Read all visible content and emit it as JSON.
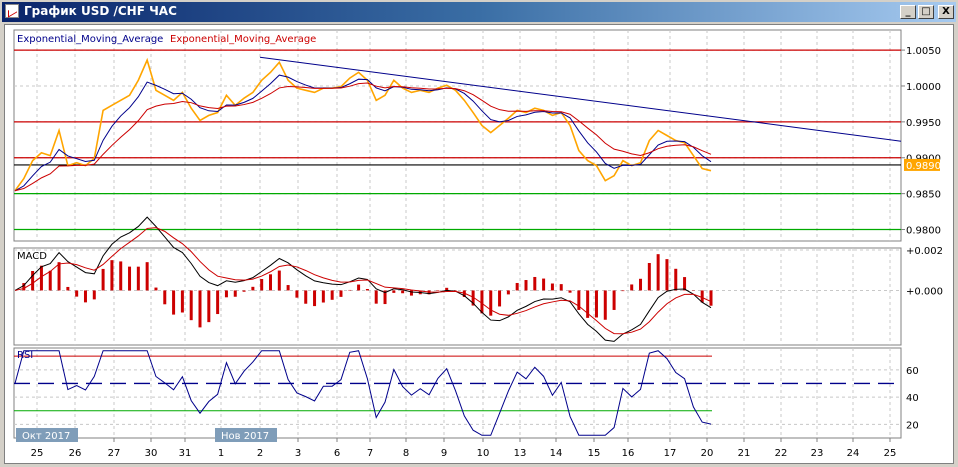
{
  "window": {
    "title": "График USD /CHF  ЧАС",
    "buttons": {
      "minimize": "_",
      "maximize": "□",
      "close": "X"
    }
  },
  "colors": {
    "price": "#ffa500",
    "ema_fast": "#00008b",
    "ema_slow": "#cc0000",
    "resistance": "#cc0000",
    "support": "#00aa00",
    "current": "#000000",
    "trendline": "#00008b",
    "price_tag_bg": "#ffa500"
  },
  "chart_data": [
    {
      "type": "line",
      "panel": "price",
      "legend": [
        "Exponential_Moving_Average",
        "Exponential_Moving_Average"
      ],
      "ylim": [
        0.9784,
        1.0078
      ],
      "yticks": [
        "1.0050",
        "1.0000",
        "0.9950",
        "0.9900",
        "0.9850",
        "0.9800"
      ],
      "current_price": "0.9890",
      "grid": true,
      "x_day_labels": [
        "25",
        "26",
        "27",
        "30",
        "31",
        "1",
        "2",
        "3",
        "6",
        "7",
        "8",
        "9",
        "10",
        "13",
        "14",
        "15",
        "16",
        "17",
        "20",
        "21",
        "22",
        "23",
        "24",
        "25"
      ],
      "month_labels": [
        "Окт 2017",
        "Нов 2017"
      ],
      "levels": [
        {
          "value": 1.005,
          "kind": "resistance"
        },
        {
          "value": 0.995,
          "kind": "resistance"
        },
        {
          "value": 0.99,
          "kind": "resistance"
        },
        {
          "value": 0.989,
          "kind": "current"
        },
        {
          "value": 0.985,
          "kind": "support"
        },
        {
          "value": 0.98,
          "kind": "support"
        }
      ],
      "trendline": {
        "from": {
          "day": "2",
          "value": 1.004
        },
        "to": {
          "day": "25",
          "value": 0.9925
        }
      },
      "series": [
        {
          "values": [
            0.9854,
            0.9871,
            0.9896,
            0.9907,
            0.9903,
            0.9938,
            0.9889,
            0.9893,
            0.9889,
            0.9899,
            0.9966,
            0.9973,
            0.998,
            0.9987,
            1.0008,
            1.0036,
            0.9994,
            0.9987,
            0.998,
            0.9991,
            0.9969,
            0.9952,
            0.9959,
            0.9963,
            0.9987,
            0.9973,
            0.9983,
            0.9991,
            1.0008,
            1.0019,
            1.0033,
            1.0008,
            0.9997,
            0.9994,
            0.9991,
            0.9997,
            0.9997,
            0.9999,
            1.0011,
            1.0019,
            1.0008,
            0.998,
            0.9987,
            1.0008,
            0.9997,
            0.9991,
            0.9994,
            0.9991,
            0.9997,
            1.0001,
            0.9994,
            0.998,
            0.9963,
            0.9945,
            0.9935,
            0.9945,
            0.9955,
            0.9966,
            0.9963,
            0.9969,
            0.9966,
            0.9959,
            0.9963,
            0.9945,
            0.991,
            0.9896,
            0.9889,
            0.9868,
            0.9875,
            0.9896,
            0.9889,
            0.9893,
            0.9924,
            0.9938,
            0.9931,
            0.9924,
            0.9921,
            0.9903,
            0.9885,
            0.9882
          ]
        }
      ]
    },
    {
      "type": "bar",
      "panel": "macd",
      "title": "MACD",
      "yticks": [
        "+0.002",
        "+0.000"
      ],
      "ylim": [
        -0.0027,
        0.0021
      ]
    },
    {
      "type": "line",
      "panel": "rsi",
      "title": "RSI",
      "yticks": [
        "60",
        "40",
        "20"
      ],
      "ylim": [
        10,
        76
      ],
      "levels": [
        70,
        50,
        30
      ]
    }
  ]
}
